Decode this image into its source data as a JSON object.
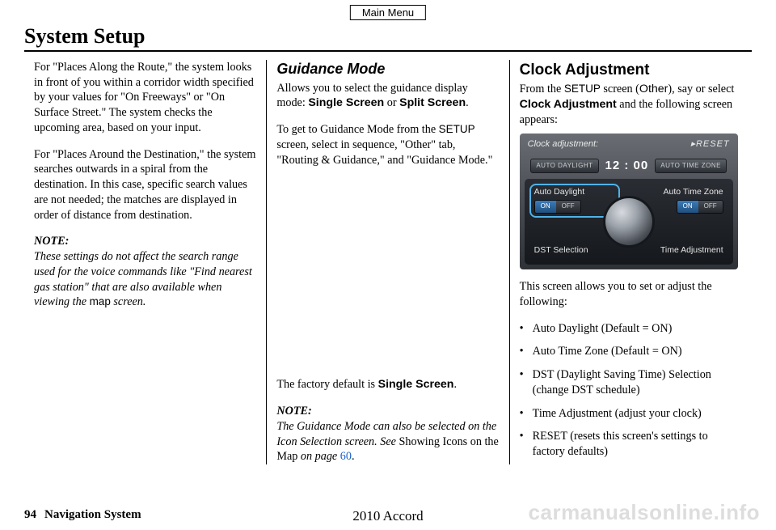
{
  "mainMenu": "Main Menu",
  "title": "System Setup",
  "col1": {
    "p1_a": "For \"Places Along the Route,\" the system looks in front of you within a corridor width specified by your values for \"On Freeways\" or \"On Surface Street.\" The system checks the upcoming area, based on your input.",
    "p2": "For \"Places Around the Destination,\" the system searches outwards in a spiral from the destination. In this case, specific search values are not needed; the matches are displayed in order of distance from destination.",
    "noteLabel": "NOTE:",
    "note_a": "These settings do not affect the search range used for the voice commands like \"Find nearest gas station\" that are also available when viewing the ",
    "note_map": "map",
    "note_b": " screen."
  },
  "col2": {
    "heading": "Guidance Mode",
    "p1_a": "Allows you to select the guidance display mode: ",
    "singleScreen": "Single Screen",
    "or": " or ",
    "splitScreen": "Split Screen",
    "period": ".",
    "p2_a": "To get to Guidance Mode from the ",
    "setup": "SETUP",
    "p2_b": " screen, select in sequence, \"Other\" tab, \"Routing & Guidance,\" and \"Guidance Mode.\"",
    "default_a": "The factory default is ",
    "default_b": "Single Screen",
    "noteLabel": "NOTE:",
    "note_a": "The Guidance Mode can also be selected on the Icon Selection screen. See ",
    "note_ref": "Showing Icons on the Map",
    "note_b": " on page ",
    "note_page": "60",
    "note_end": "."
  },
  "col3": {
    "heading": "Clock Adjustment",
    "intro_a": "From the ",
    "setup": "SETUP",
    "intro_b": " screen (",
    "other": "Other",
    "intro_c": "), say or select ",
    "clockAdj": "Clock Adjustment",
    "intro_d": " and the following screen appears:",
    "screen": {
      "title": "Clock adjustment:",
      "reset": "▸RESET",
      "badgeL": "AUTO DAYLIGHT",
      "time": "12 : 00",
      "badgeR": "AUTO TIME ZONE",
      "autoDaylight": "Auto Daylight",
      "autoTimeZone": "Auto Time Zone",
      "dst": "DST Selection",
      "timeAdj": "Time Adjustment",
      "on": "ON",
      "off": "OFF"
    },
    "afterImg": "This screen allows you to set or adjust the following:",
    "bullets": [
      "Auto Daylight (Default = ON)",
      "Auto Time Zone (Default = ON)",
      "DST (Daylight Saving Time) Selection (change DST schedule)",
      "Time Adjustment (adjust your clock)",
      "RESET (resets this screen's settings to factory defaults)"
    ]
  },
  "footer": {
    "page": "94",
    "section": "Navigation System",
    "model": "2010 Accord"
  },
  "watermark": "carmanualsonline.info"
}
